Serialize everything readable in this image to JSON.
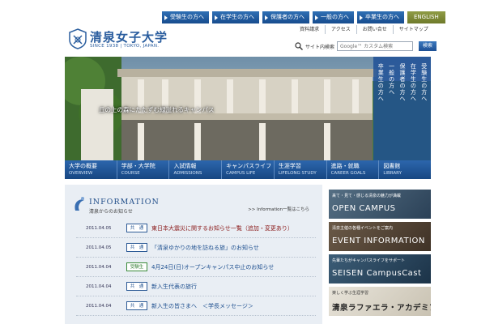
{
  "tabs": [
    "受験生の方へ",
    "在学生の方へ",
    "保護者の方へ",
    "一般の方へ",
    "卒業生の方へ",
    "ENGLISH"
  ],
  "logo": {
    "title": "清泉女子大学",
    "subtitle": "SINCE 1938 | TOKYO, JAPAN."
  },
  "util_links": [
    "資料請求",
    "アクセス",
    "お問い合せ",
    "サイトマップ"
  ],
  "search": {
    "label": "サイト内検索",
    "placeholder": "Google™ カスタム検索",
    "button": "検索"
  },
  "hero": {
    "caption": "丘の上の森にたたずむ緑溢れるキャンパス"
  },
  "side_nav": [
    "受験生の方へ",
    "在学生の方へ",
    "保護者の方へ",
    "一般の方へ",
    "卒業生の方へ"
  ],
  "main_nav": [
    {
      "jp": "大学の概要",
      "en": "OVERVIEW"
    },
    {
      "jp": "学部・大学院",
      "en": "COURSE"
    },
    {
      "jp": "入試情報",
      "en": "ADMISSIONS"
    },
    {
      "jp": "キャンパスライフ",
      "en": "CAMPUS LIFE"
    },
    {
      "jp": "生涯学習",
      "en": "LIFELONG STUDY"
    },
    {
      "jp": "進路・就職",
      "en": "CAREER GOALS"
    },
    {
      "jp": "図書館",
      "en": "LIBRARY"
    }
  ],
  "info": {
    "title": "INFORMATION",
    "subtitle": "清泉からのお知らせ",
    "more": ">> Information一覧はこちら"
  },
  "news": [
    {
      "date": "2011.04.05",
      "badge": "共　通",
      "title": "東日本大震災に関するお知らせ一覧（追加・変更あり）",
      "badge_color": "blue",
      "title_color": "red"
    },
    {
      "date": "2011.04.05",
      "badge": "共　通",
      "title": "「清泉ゆかりの地を訪ねる旅」のお知らせ",
      "badge_color": "blue",
      "title_color": "blue"
    },
    {
      "date": "2011.04.04",
      "badge": "受験生",
      "title": "4月24日(日)オープンキャンパス中止のお知らせ",
      "badge_color": "green",
      "title_color": "blue"
    },
    {
      "date": "2011.04.04",
      "badge": "共　通",
      "title": "新入生代表の旅行",
      "badge_color": "blue",
      "title_color": "blue"
    },
    {
      "date": "2011.04.04",
      "badge": "共　通",
      "title": "新入生の皆さまへ　＜学長メッセージ＞",
      "badge_color": "blue",
      "title_color": "blue"
    }
  ],
  "banners": [
    {
      "small": "来て・見て・感じる清泉の魅力が満載",
      "big": "OPEN CAMPUS"
    },
    {
      "small": "清泉主催の各種イベントをご案内",
      "big": "EVENT INFORMATION"
    },
    {
      "small": "先輩たちがキャンパスライフをサポート",
      "big": "SEISEN CampusCast"
    },
    {
      "small": "楽しく学ぶ生涯学習",
      "big": "清泉ラファエラ・アカデミア"
    }
  ]
}
